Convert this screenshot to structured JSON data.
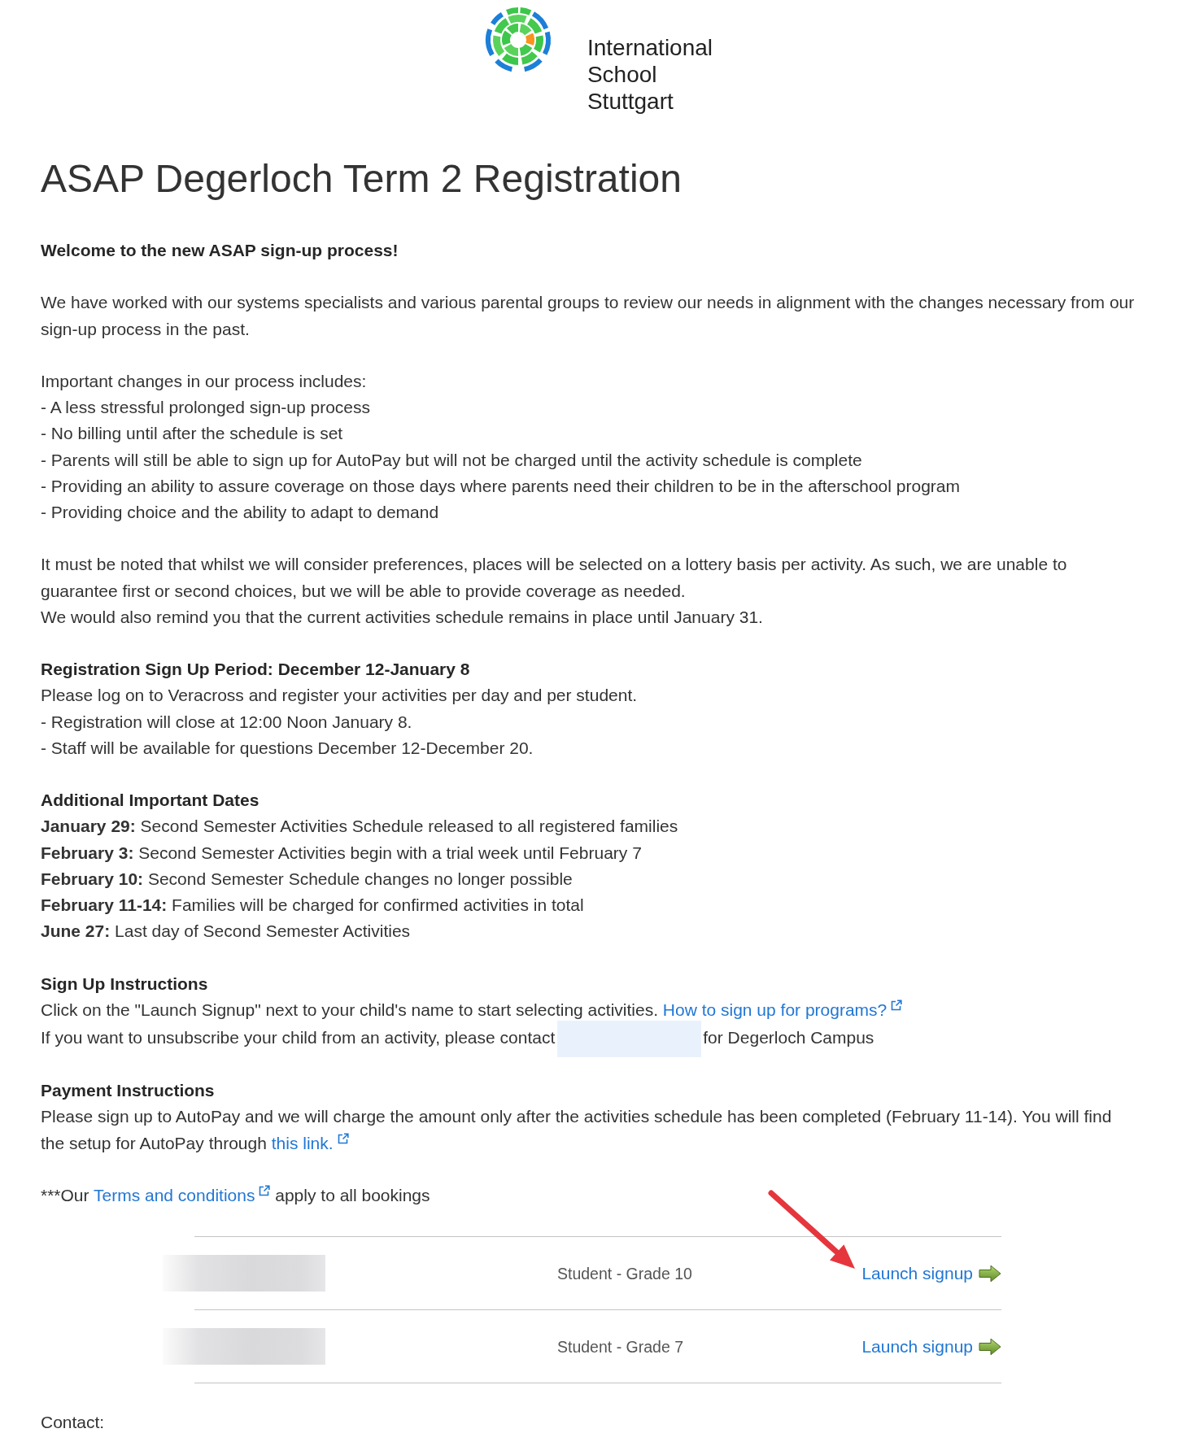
{
  "logo": {
    "lines": [
      "International",
      "School",
      "Stuttgart"
    ]
  },
  "title": "ASAP Degerloch Term 2 Registration",
  "welcome": "Welcome to the new ASAP sign-up process!",
  "intro": "We have worked with our systems specialists and various parental groups to review our needs in alignment with the changes necessary from our sign-up process in the past.",
  "changes": {
    "heading": "Important changes in our process includes:",
    "items": [
      "- A less stressful prolonged sign-up process",
      "- No billing until after the schedule is set",
      "- Parents will still be able to sign up for AutoPay but will not be charged until the activity schedule is complete",
      "- Providing an ability to assure coverage on those days where parents need their children to be in the afterschool program",
      "- Providing choice and the ability to adapt to demand"
    ]
  },
  "notice": [
    "It must be noted that whilst we will consider preferences, places will be selected on a lottery basis per activity. As such, we are unable to guarantee first or second choices, but we will be able to provide coverage as needed.",
    "We would also remind you that the current activities schedule remains in place until January 31."
  ],
  "registration": {
    "heading": "Registration Sign Up Period: December 12-January 8",
    "lines": [
      "Please log on to Veracross and register your activities per day and per student.",
      "- Registration will close at 12:00 Noon January 8.",
      "- Staff will be available for questions December 12-December 20."
    ]
  },
  "dates": {
    "heading": "Additional Important Dates",
    "items": [
      "**January 29:** Second Semester Activities Schedule released to all registered families",
      "**February 3:** Second Semester Activities begin with a trial week until February 7",
      "**February 10:** Second Semester Schedule changes no longer possible",
      "**February 11-14:** Families will be charged for confirmed activities in total",
      "**June 27:** Last day of Second Semester Activities"
    ]
  },
  "instructions": {
    "heading": "Sign Up Instructions",
    "text": "Click on the \"Launch Signup\" next to your child's name to start selecting activities.",
    "link": "How to sign up for programs?",
    "contact": {
      "before": "If you want to unsubscribe your child from an activity, please contact",
      "redacted": true,
      "after": "for Degerloch Campus"
    }
  },
  "payment": {
    "heading": "Payment Instructions",
    "text": "Please sign up to AutoPay and we will charge the amount only after the activities schedule has been completed (February 11-14). You will find the setup for AutoPay through",
    "link": "this link."
  },
  "terms": {
    "before": "***Our",
    "link": "Terms and conditions",
    "after": "apply to all bookings"
  },
  "students": [
    {
      "name_redacted": true,
      "role": "Student - Grade 10",
      "action": "Launch signup",
      "annotated": true
    },
    {
      "name_redacted": true,
      "role": "Student - Grade 7",
      "action": "Launch signup",
      "annotated": false
    }
  ],
  "contact_label": "Contact:"
}
